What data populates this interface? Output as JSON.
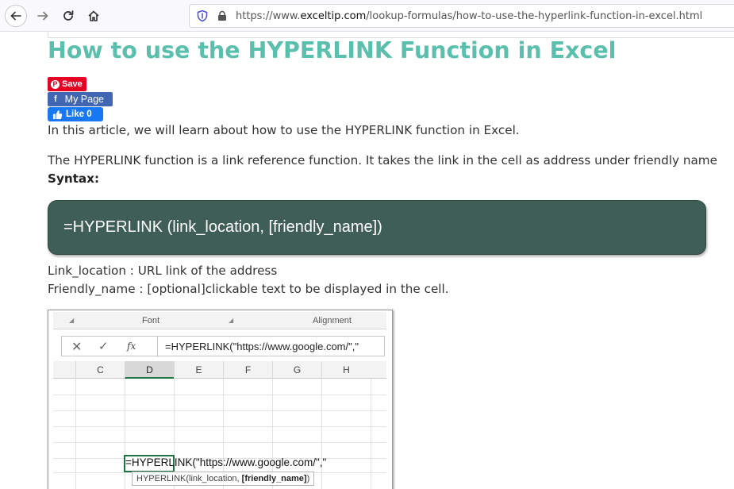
{
  "browser": {
    "url_prefix": "https://www.",
    "url_domain": "exceltip.com",
    "url_path": "/lookup-formulas/how-to-use-the-hyperlink-function-in-excel.html",
    "accent": "#5bbfad"
  },
  "article": {
    "title": "How to use the HYPERLINK Function in Excel",
    "intro": "In this article, we will learn about how to use the HYPERLINK function in Excel.",
    "description": "The HYPERLINK function is a link reference function. It takes the link in the cell as address under friendly name",
    "syntax_label": "Syntax:",
    "syntax_formula": "=HYPERLINK (link_location, [friendly_name])",
    "arg1": "Link_location : URL link of the address",
    "arg2": "Friendly_name : [optional]clickable text to be displayed in the cell."
  },
  "social": {
    "pinterest_label": "Save",
    "facebook_label": "My Page",
    "like_label": "Like 0"
  },
  "excel": {
    "ribbon_groups": [
      "Font",
      "Alignment"
    ],
    "formula_bar_text": "=HYPERLINK(\"https://www.google.com/\",\"",
    "columns": [
      "C",
      "D",
      "E",
      "F",
      "G",
      "H"
    ],
    "selected_column": "D",
    "cell_edit_text": "=HYPERLINK(\"https://www.google.com/\",\"",
    "tooltip_prefix": "HYPERLINK(link_location, ",
    "tooltip_bold": "[friendly_name]",
    "tooltip_suffix": ")"
  }
}
